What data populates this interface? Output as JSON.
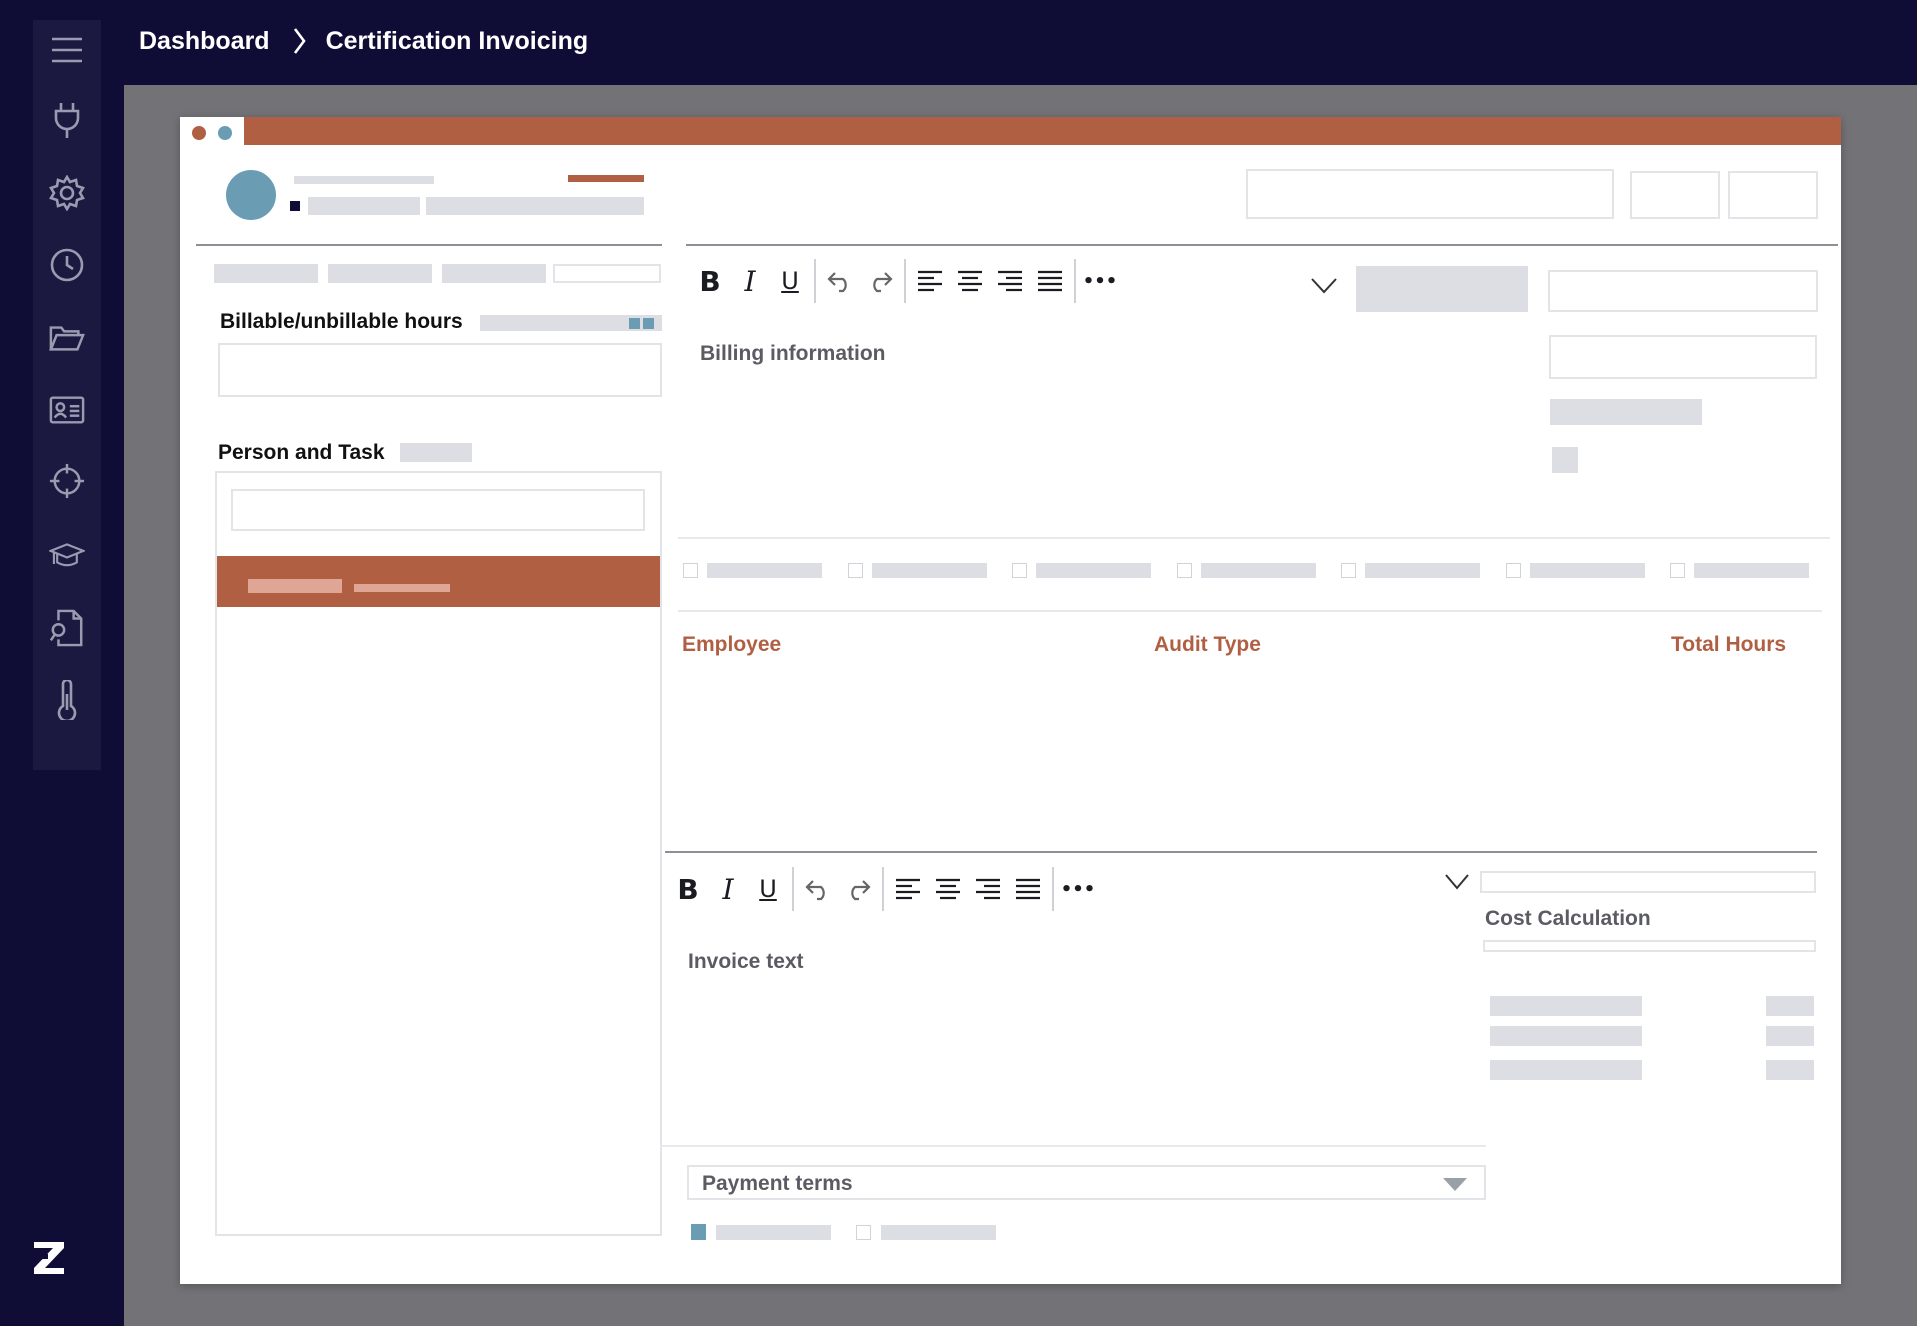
{
  "breadcrumb": {
    "root": "Dashboard",
    "current": "Certification Invoicing"
  },
  "sidebar": {
    "icons": [
      "menu-icon",
      "plug-icon",
      "gear-icon",
      "clock-icon",
      "folder-icon",
      "id-card-icon",
      "crosshair-icon",
      "graduation-cap-icon",
      "file-search-icon",
      "thermometer-icon"
    ],
    "logo": "Z"
  },
  "panel_left": {
    "hours_label": "Billable/unbillable hours",
    "person_task_label": "Person and Task"
  },
  "billing_editor": {
    "placeholder": "Billing information",
    "toolbar": {
      "bold": "B",
      "italic": "I",
      "underline": "U",
      "more": "•••"
    }
  },
  "table": {
    "columns": [
      "Employee",
      "Audit Type",
      "Total Hours"
    ]
  },
  "invoice_editor": {
    "placeholder": "Invoice text",
    "toolbar": {
      "bold": "B",
      "italic": "I",
      "underline": "U",
      "more": "•••"
    }
  },
  "cost": {
    "title": "Cost Calculation"
  },
  "payment": {
    "label": "Payment terms"
  },
  "colors": {
    "navy": "#0f0d35",
    "accent": "#b15f43",
    "teal": "#6a9db4",
    "placeholder": "#dcdee3"
  }
}
